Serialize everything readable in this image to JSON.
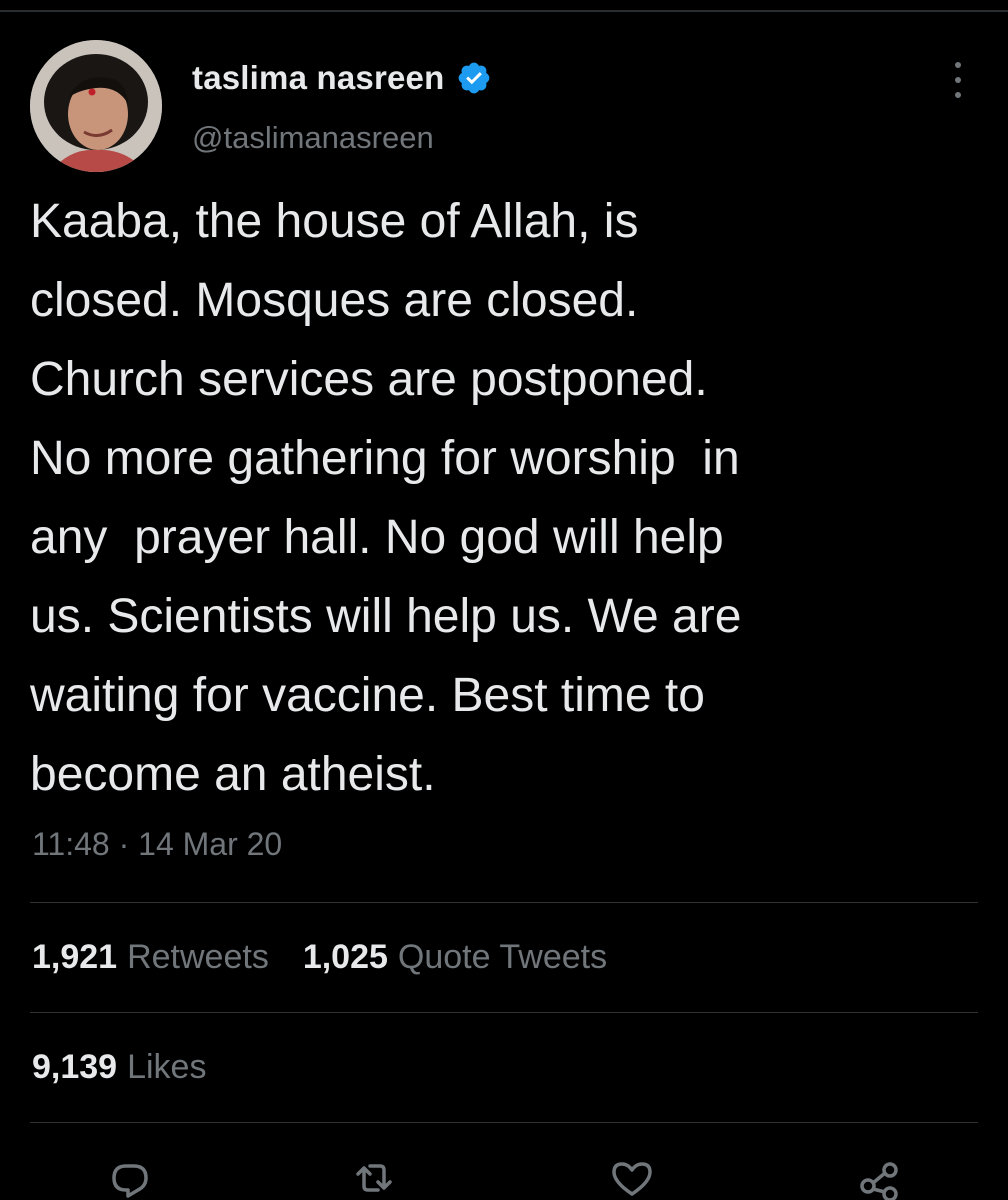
{
  "tweet": {
    "author": {
      "display_name": "taslima nasreen",
      "handle": "@taslimanasreen",
      "verified": true,
      "avatar_icon": "profile-photo"
    },
    "text": "Kaaba, the house of Allah, is\nclosed. Mosques are closed.\nChurch services are postponed.\nNo more gathering for worship  in\nany  prayer hall. No god will help\nus. Scientists will help us. We are\nwaiting for vaccine. Best time to\nbecome an atheist.",
    "time": "11:48",
    "separator": "·",
    "date": "14 Mar 20",
    "stats": {
      "retweets_count": "1,921",
      "retweets_label": "Retweets",
      "quote_tweets_count": "1,025",
      "quote_tweets_label": "Quote Tweets",
      "likes_count": "9,139",
      "likes_label": "Likes"
    }
  },
  "actions": [
    {
      "name": "reply",
      "icon": "reply-icon"
    },
    {
      "name": "retweet",
      "icon": "retweet-icon"
    },
    {
      "name": "like",
      "icon": "heart-icon"
    },
    {
      "name": "share",
      "icon": "share-icon"
    }
  ],
  "colors": {
    "background": "#000000",
    "text_primary": "#e7e9ea",
    "text_secondary": "#71767b",
    "divider": "#2f3336",
    "verified_blue": "#1d9bf0"
  }
}
